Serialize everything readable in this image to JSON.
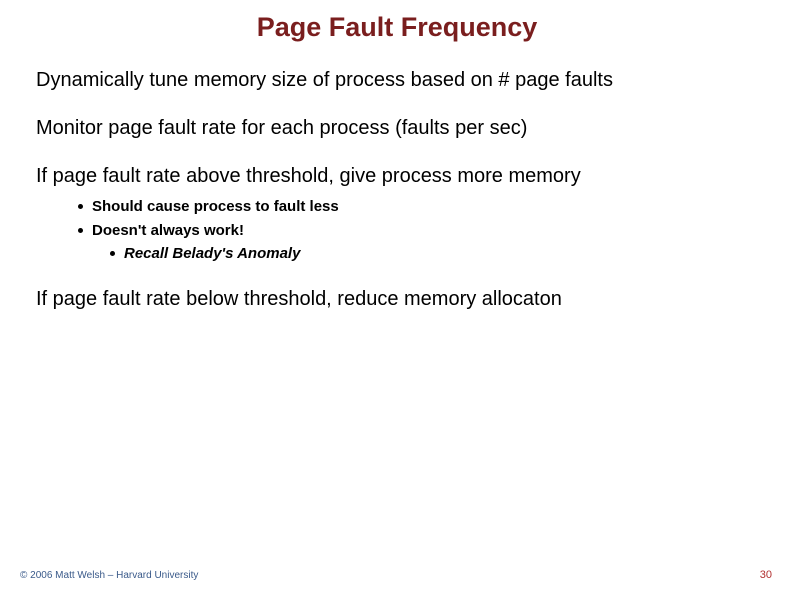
{
  "title": "Page Fault Frequency",
  "points": {
    "p1": "Dynamically tune memory size of process based on # page faults",
    "p2": "Monitor page fault rate for each process (faults per sec)",
    "p3": "If page fault rate above threshold, give process more memory",
    "p3_subs": {
      "s1": "Should cause process to fault less",
      "s2": "Doesn't always work!",
      "s2_sub": "Recall Belady's Anomaly"
    },
    "p4": "If page fault rate below threshold, reduce memory allocaton"
  },
  "footer": {
    "copyright": "© 2006 Matt Welsh – Harvard University",
    "page_number": "30"
  }
}
